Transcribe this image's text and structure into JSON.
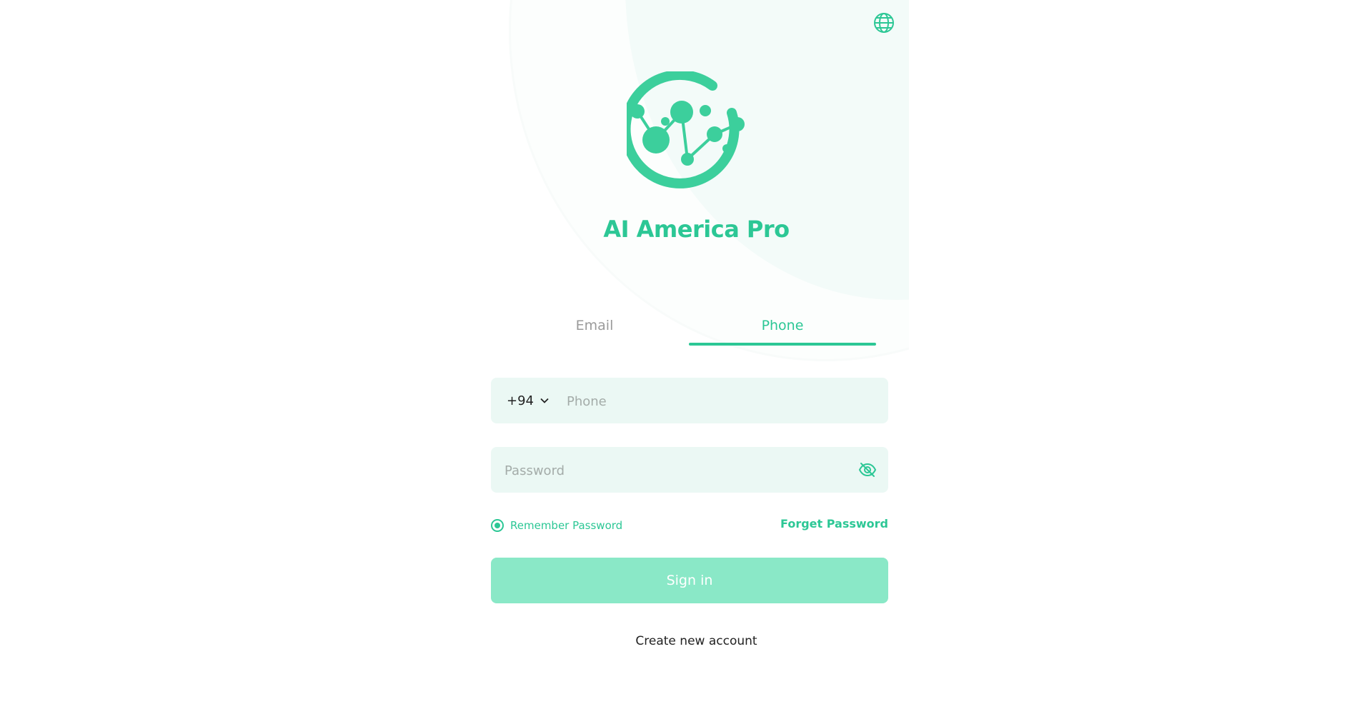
{
  "brand": {
    "name": "AI America Pro",
    "accent_color": "#2cc795",
    "logo_icon": "network-globe-logo"
  },
  "header": {
    "language_icon": "globe-icon"
  },
  "tabs": [
    {
      "label": "Email",
      "active": false
    },
    {
      "label": "Phone",
      "active": true
    }
  ],
  "form": {
    "country_code": "+94",
    "phone_placeholder": "Phone",
    "phone_value": "",
    "password_placeholder": "Password",
    "password_value": "",
    "remember_label": "Remember Password",
    "remember_checked": true,
    "forget_label": "Forget Password",
    "signin_label": "Sign in",
    "create_account_label": "Create new account"
  }
}
